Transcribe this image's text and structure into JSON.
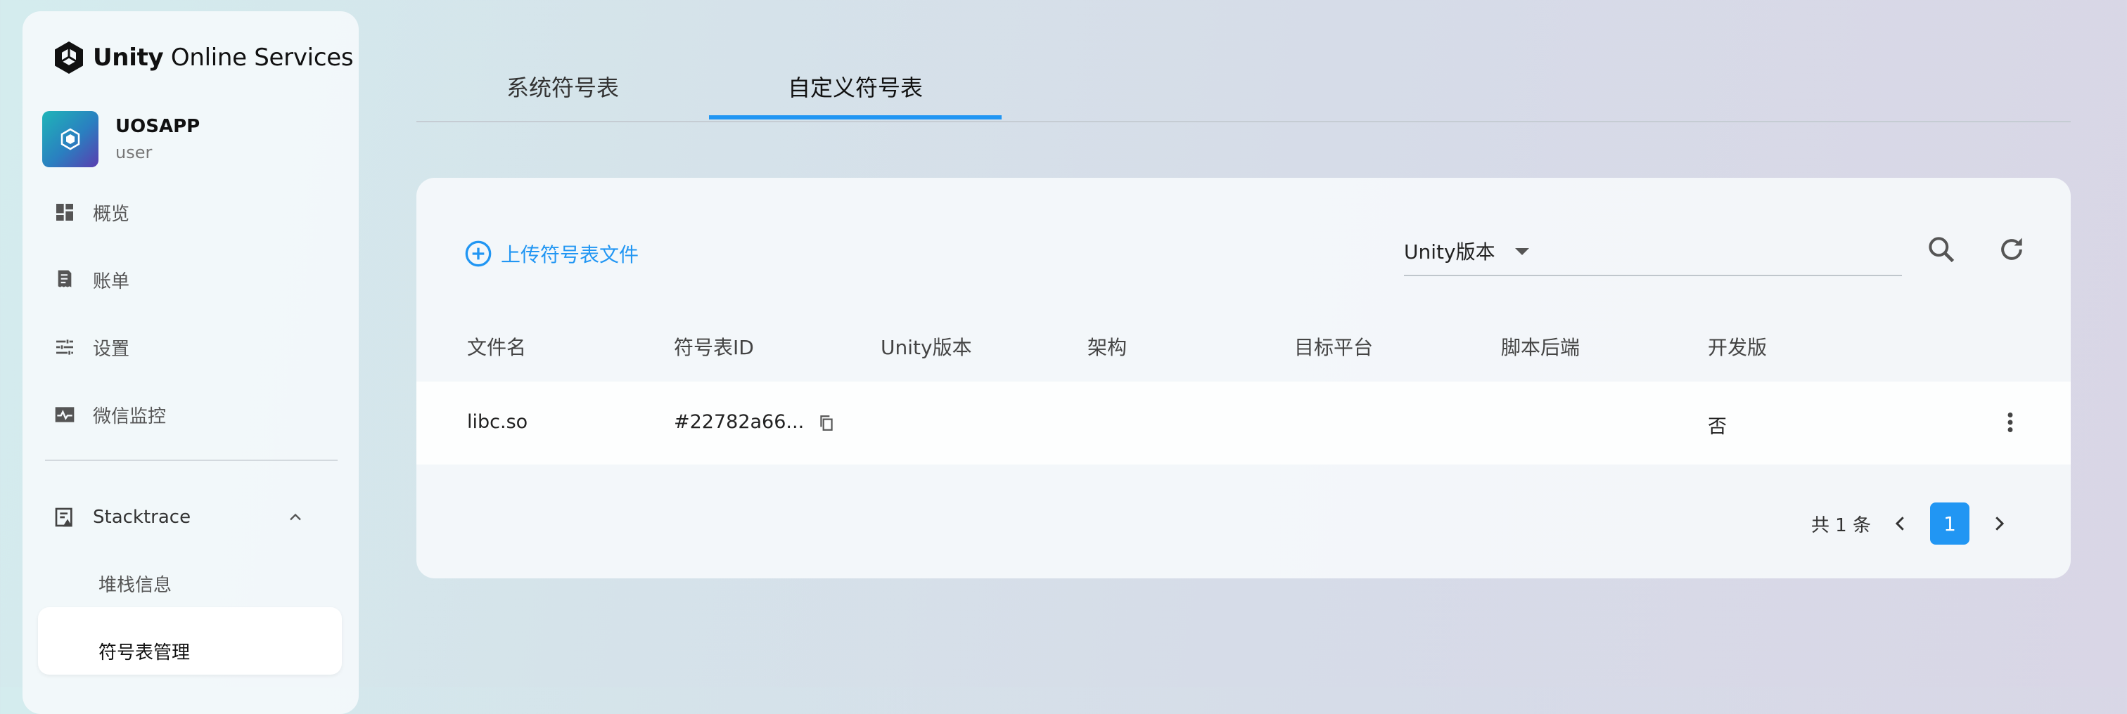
{
  "brand": {
    "name_bold": "Unity",
    "name_rest": " Online Services"
  },
  "app": {
    "name": "UOSAPP",
    "role": "user"
  },
  "nav": [
    {
      "label": "概览",
      "icon": "dashboard-icon"
    },
    {
      "label": "账单",
      "icon": "receipt-icon"
    },
    {
      "label": "设置",
      "icon": "sliders-icon"
    },
    {
      "label": "微信监控",
      "icon": "monitor-chart-icon"
    }
  ],
  "stacktrace": {
    "label": "Stacktrace",
    "children": [
      {
        "label": "堆栈信息"
      },
      {
        "label": "符号表管理",
        "active": true
      }
    ]
  },
  "tabs": [
    {
      "label": "系统符号表",
      "active": false
    },
    {
      "label": "自定义符号表",
      "active": true
    }
  ],
  "toolbar": {
    "upload_label": "上传符号表文件",
    "filter_value": "Unity版本"
  },
  "table": {
    "columns": [
      "文件名",
      "符号表ID",
      "Unity版本",
      "架构",
      "目标平台",
      "脚本后端",
      "开发版"
    ],
    "rows": [
      {
        "file": "libc.so",
        "id": "#22782a66...",
        "unity": "",
        "arch": "",
        "platform": "",
        "backend": "",
        "dev": "否"
      }
    ]
  },
  "pagination": {
    "total_text": "共 1 条",
    "current": "1"
  },
  "colors": {
    "accent": "#2196f3"
  }
}
